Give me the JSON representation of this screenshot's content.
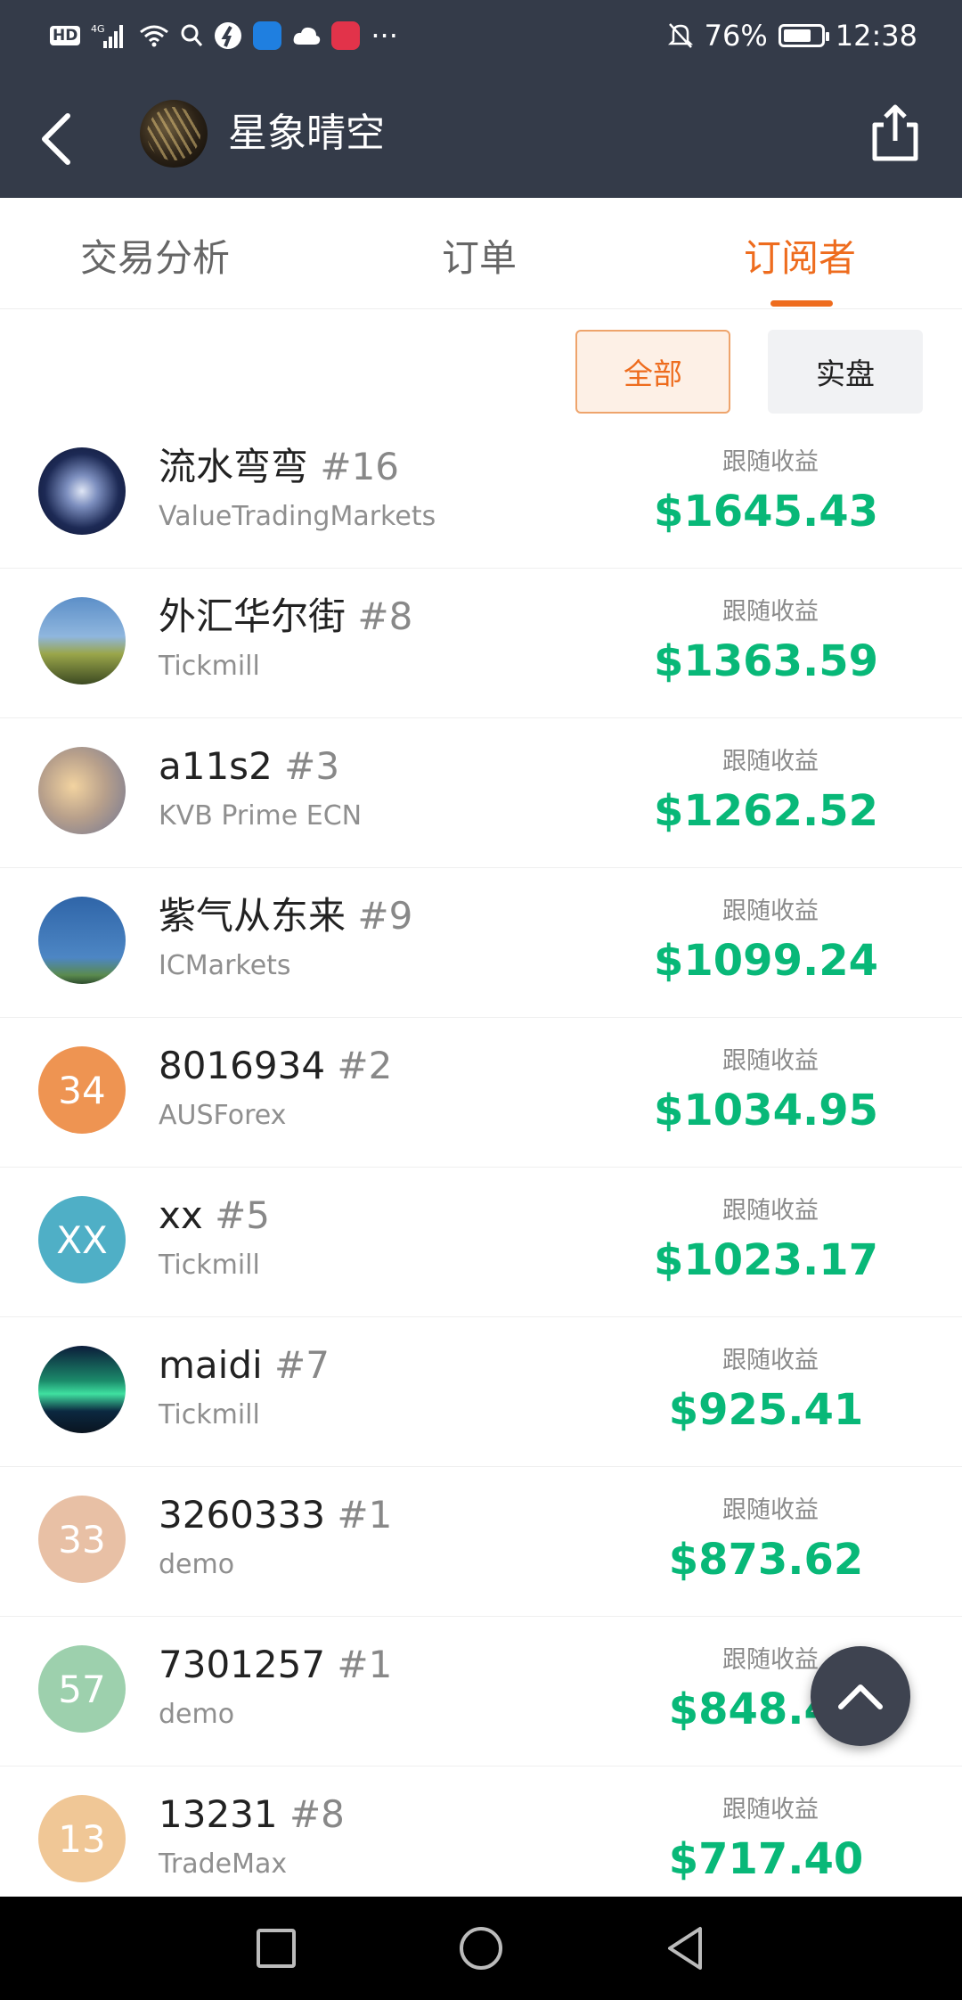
{
  "status_bar": {
    "hd": "HD",
    "network": "4G",
    "battery": "76%",
    "battery_level": 0.76,
    "time": "12:38",
    "more": "···"
  },
  "header": {
    "title": "星象晴空"
  },
  "tabs": [
    {
      "label": "交易分析",
      "active": false
    },
    {
      "label": "订单",
      "active": false
    },
    {
      "label": "订阅者",
      "active": true
    }
  ],
  "filters": {
    "all": "全部",
    "real": "实盘",
    "selected": "全部"
  },
  "gain_label": "跟随收益",
  "subscribers": [
    {
      "name": "流水弯弯",
      "rank": "#16",
      "broker": "ValueTradingMarkets",
      "gain": "$1645.43",
      "avatar_type": "image",
      "avatar_desc": "yin-yang galaxy",
      "avatar_color": "#2b3a6b"
    },
    {
      "name": "外汇华尔街",
      "rank": "#8",
      "broker": "Tickmill",
      "gain": "$1363.59",
      "avatar_type": "image",
      "avatar_desc": "trees sky",
      "avatar_color": "#4f7fb3"
    },
    {
      "name": "a11s2",
      "rank": "#3",
      "broker": "KVB Prime ECN",
      "gain": "$1262.52",
      "avatar_type": "image",
      "avatar_desc": "sunset clouds",
      "avatar_color": "#c9a57a"
    },
    {
      "name": "紫气从东来",
      "rank": "#9",
      "broker": "ICMarkets",
      "gain": "$1099.24",
      "avatar_type": "image",
      "avatar_desc": "blue sky",
      "avatar_color": "#3f78b8"
    },
    {
      "name": "8016934",
      "rank": "#2",
      "broker": "AUSForex",
      "gain": "$1034.95",
      "avatar_type": "text",
      "avatar_text": "34",
      "avatar_color": "#ee9452"
    },
    {
      "name": "xx ",
      "rank": "#5",
      "broker": "Tickmill",
      "gain": "$1023.17",
      "avatar_type": "text",
      "avatar_text": "XX",
      "avatar_color": "#4fafc6"
    },
    {
      "name": "maidi",
      "rank": "#7",
      "broker": "Tickmill",
      "gain": "$925.41",
      "avatar_type": "image",
      "avatar_desc": "aurora",
      "avatar_color": "#0f3a3a"
    },
    {
      "name": "3260333",
      "rank": "#1",
      "broker": "demo",
      "gain": "$873.62",
      "avatar_type": "text",
      "avatar_text": "33",
      "avatar_color": "#e8c0a5"
    },
    {
      "name": "7301257",
      "rank": "#1",
      "broker": "demo",
      "gain": "$848.44",
      "avatar_type": "text",
      "avatar_text": "57",
      "avatar_color": "#9dd0ad"
    },
    {
      "name": "13231",
      "rank": "#8",
      "broker": "TradeMax",
      "gain": "$717.40",
      "avatar_type": "text",
      "avatar_text": "13",
      "avatar_color": "#f0c796"
    }
  ]
}
